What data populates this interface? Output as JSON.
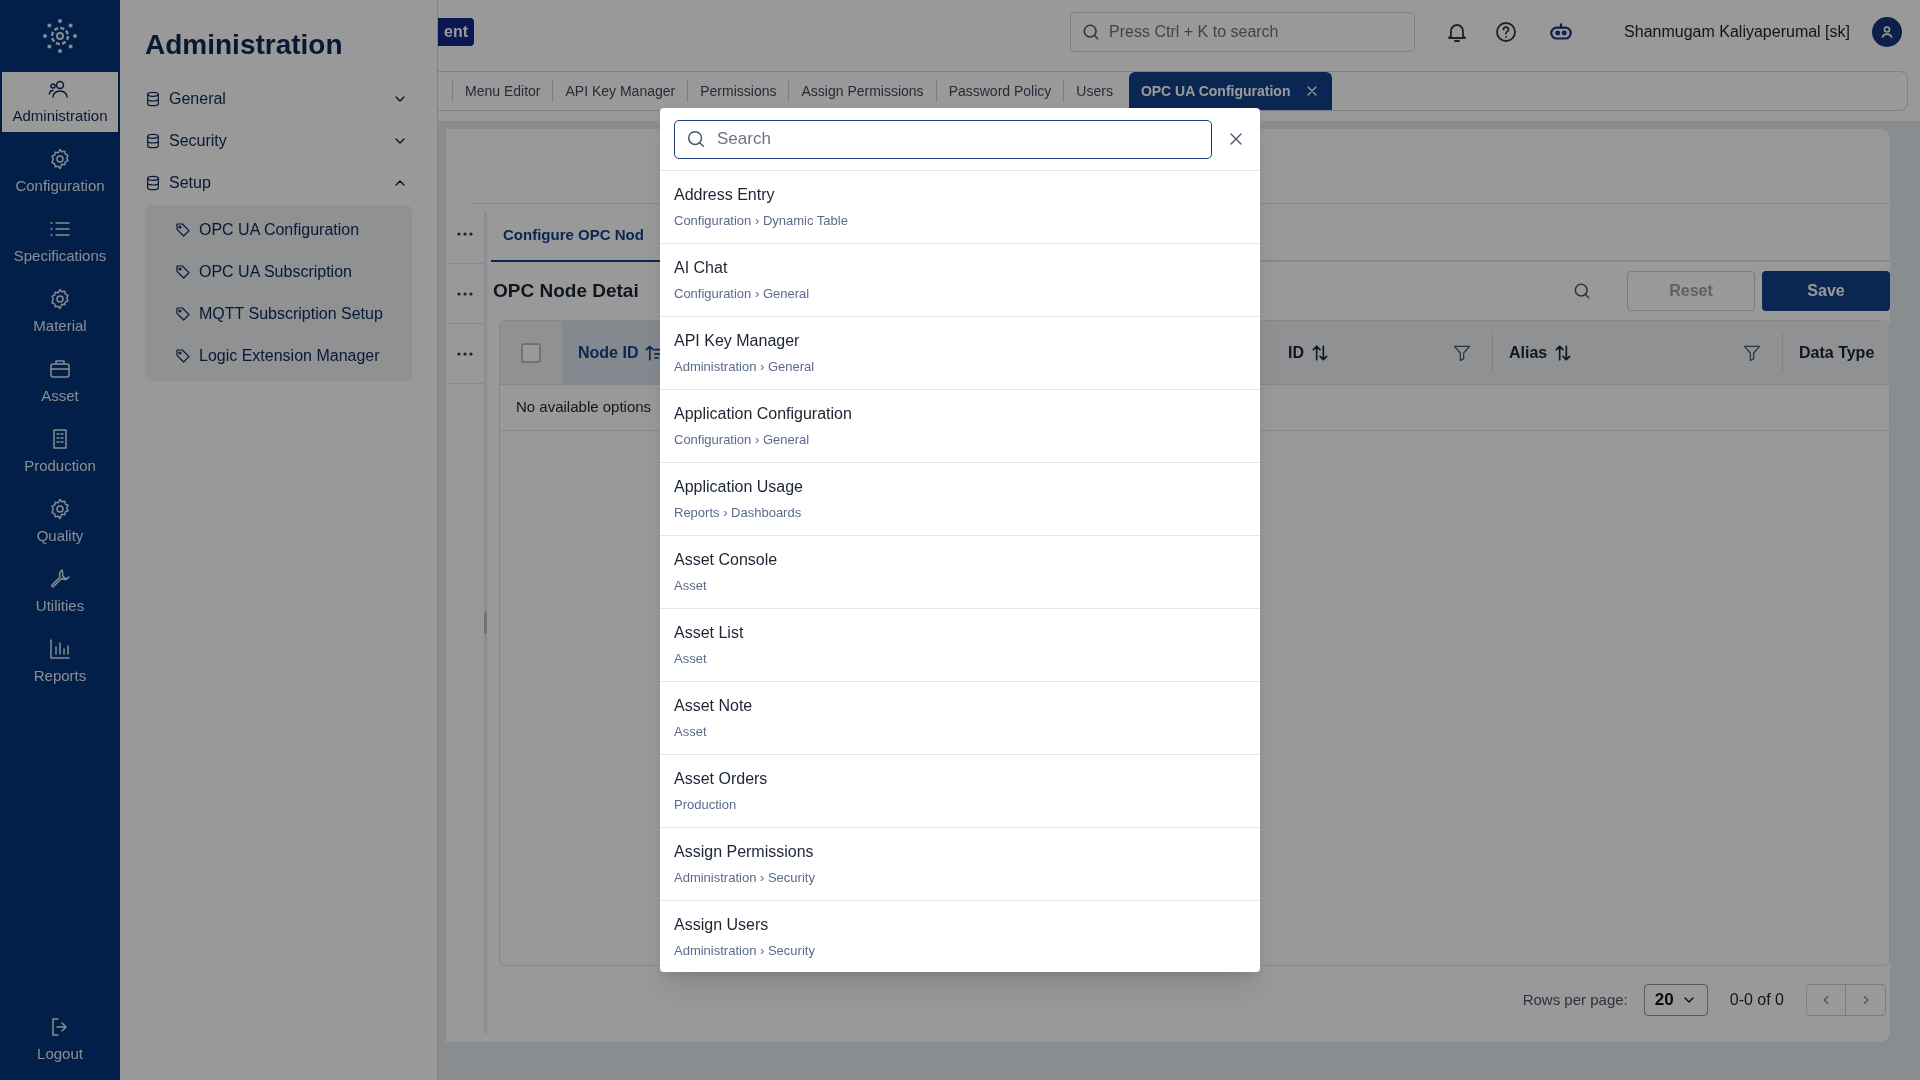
{
  "rail": {
    "items": [
      {
        "label": "Administration",
        "kind": "users",
        "selected": true
      },
      {
        "label": "Configuration",
        "kind": "gear",
        "selected": false
      },
      {
        "label": "Specifications",
        "kind": "list",
        "selected": false
      },
      {
        "label": "Material",
        "kind": "gear",
        "selected": false
      },
      {
        "label": "Asset",
        "kind": "briefcase",
        "selected": false
      },
      {
        "label": "Production",
        "kind": "building",
        "selected": false
      },
      {
        "label": "Quality",
        "kind": "gear",
        "selected": false
      },
      {
        "label": "Utilities",
        "kind": "wrench",
        "selected": false
      },
      {
        "label": "Reports",
        "kind": "chart",
        "selected": false
      }
    ],
    "logout": "Logout"
  },
  "panel": {
    "title": "Administration",
    "groups": [
      {
        "label": "General",
        "expanded": false
      },
      {
        "label": "Security",
        "expanded": false
      },
      {
        "label": "Setup",
        "expanded": true,
        "children": [
          {
            "label": "OPC UA Configuration"
          },
          {
            "label": "OPC UA Subscription"
          },
          {
            "label": "MQTT Subscription Setup"
          },
          {
            "label": "Logic Extension Manager"
          }
        ]
      }
    ]
  },
  "header": {
    "badge": "ent",
    "search_placeholder": "Press Ctrl + K to search",
    "user": "Shanmugam Kaliyaperumal [sk]"
  },
  "tabs": [
    {
      "label": "Menu Editor",
      "selected": false
    },
    {
      "label": "API Key Manager",
      "selected": false
    },
    {
      "label": "Permissions",
      "selected": false
    },
    {
      "label": "Assign Permissions",
      "selected": false
    },
    {
      "label": "Password Policy",
      "selected": false
    },
    {
      "label": "Users",
      "selected": false
    },
    {
      "label": "OPC UA Configuration",
      "selected": true
    }
  ],
  "content": {
    "sub_tab": "Configure OPC Nod",
    "heading": "OPC Node Detai",
    "buttons": [
      {
        "label": "Reset",
        "disabled": true
      },
      {
        "label": "Save",
        "disabled": false
      }
    ],
    "columns": [
      {
        "label": "Node ID",
        "sortable": true,
        "sorted": true,
        "filter": false
      },
      {
        "label": "ID",
        "sortable": true,
        "sorted": false,
        "filter": true
      },
      {
        "label": "Alias",
        "sortable": true,
        "sorted": false,
        "filter": true
      },
      {
        "label": "Data Type"
      }
    ],
    "all_selected": false,
    "empty": "No available options",
    "pagination": {
      "rows_label": "Rows per page:",
      "rows_value": "20",
      "range": "0-0 of 0"
    }
  },
  "search_dialog": {
    "placeholder": "Search",
    "results": [
      {
        "title": "Address Entry",
        "path": "Configuration › Dynamic Table"
      },
      {
        "title": "AI Chat",
        "path": "Configuration › General"
      },
      {
        "title": "API Key Manager",
        "path": "Administration › General"
      },
      {
        "title": "Application Configuration",
        "path": "Configuration › General"
      },
      {
        "title": "Application Usage",
        "path": "Reports › Dashboards"
      },
      {
        "title": "Asset Console",
        "path": "Asset"
      },
      {
        "title": "Asset List",
        "path": "Asset"
      },
      {
        "title": "Asset Note",
        "path": "Asset"
      },
      {
        "title": "Asset Orders",
        "path": "Production"
      },
      {
        "title": "Assign Permissions",
        "path": "Administration › Security"
      },
      {
        "title": "Assign Users",
        "path": "Administration › Security"
      }
    ]
  }
}
